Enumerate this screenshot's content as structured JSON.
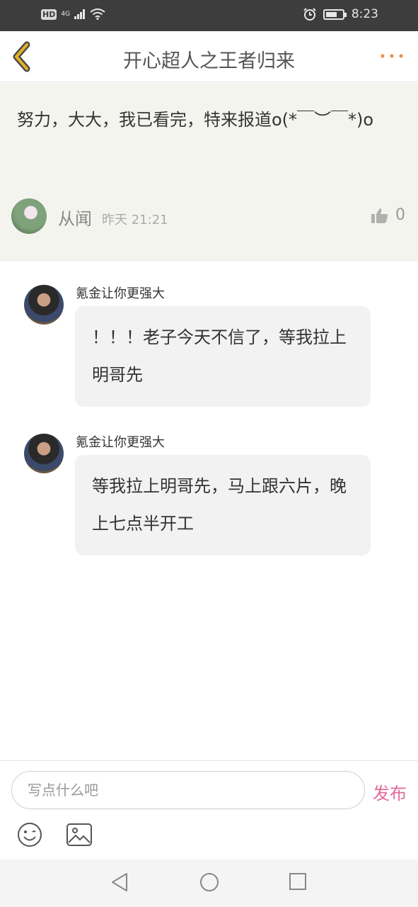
{
  "status_bar": {
    "network_badge": "HD",
    "network_type": "4G",
    "time": "8:23"
  },
  "header": {
    "title": "开心超人之王者归来"
  },
  "post": {
    "text": "努力，大大，我已看完，特来报道o(*￣︶￣*)o",
    "username": "从闻",
    "time": "昨天 21:21",
    "like_count": "0"
  },
  "comments": [
    {
      "username": "氪金让你更强大",
      "text": "！！！老子今天不信了，等我拉上明哥先"
    },
    {
      "username": "氪金让你更强大",
      "text": "等我拉上明哥先，马上跟六片，晚上七点半开工"
    }
  ],
  "input_bar": {
    "placeholder": "写点什么吧",
    "publish_label": "发布"
  },
  "colors": {
    "accent_back": "#e5b21f",
    "more_dots": "#f08a3e",
    "publish": "#e16b99",
    "post_bg": "#f4f4ef"
  }
}
